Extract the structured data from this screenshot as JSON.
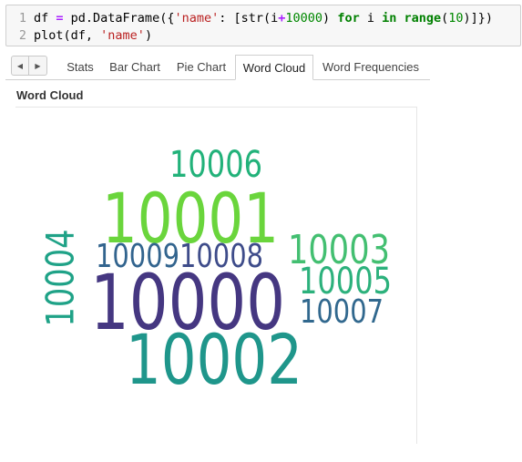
{
  "code": {
    "line_numbers": [
      "1",
      "2"
    ],
    "line1": [
      {
        "t": "df ",
        "c": "default"
      },
      {
        "t": "=",
        "c": "op"
      },
      {
        "t": " pd.DataFrame({",
        "c": "default"
      },
      {
        "t": "'name'",
        "c": "str"
      },
      {
        "t": ": [str(i",
        "c": "default"
      },
      {
        "t": "+",
        "c": "op"
      },
      {
        "t": "10000",
        "c": "num"
      },
      {
        "t": ") ",
        "c": "default"
      },
      {
        "t": "for",
        "c": "kw"
      },
      {
        "t": " i ",
        "c": "default"
      },
      {
        "t": "in",
        "c": "kw"
      },
      {
        "t": " ",
        "c": "default"
      },
      {
        "t": "range",
        "c": "kw"
      },
      {
        "t": "(",
        "c": "default"
      },
      {
        "t": "10",
        "c": "num"
      },
      {
        "t": ")]})",
        "c": "default"
      }
    ],
    "line2": [
      {
        "t": "plot(df, ",
        "c": "default"
      },
      {
        "t": "'name'",
        "c": "str"
      },
      {
        "t": ")",
        "c": "default"
      }
    ]
  },
  "tabs": {
    "prev_icon": "chevron-left-icon",
    "next_icon": "chevron-right-icon",
    "items": [
      {
        "label": "Stats",
        "active": false
      },
      {
        "label": "Bar Chart",
        "active": false
      },
      {
        "label": "Pie Chart",
        "active": false
      },
      {
        "label": "Word Cloud",
        "active": true
      },
      {
        "label": "Word Frequencies",
        "active": false
      }
    ]
  },
  "panel": {
    "title": "Word Cloud"
  },
  "word_cloud": {
    "words": [
      {
        "text": "10006",
        "color": "#22b27a",
        "rotated": false
      },
      {
        "text": "10001",
        "color": "#6ad53c",
        "rotated": false
      },
      {
        "text": "10004",
        "color": "#1fa287",
        "rotated": true
      },
      {
        "text": "10009",
        "color": "#32648e",
        "rotated": false
      },
      {
        "text": "10008",
        "color": "#3e4c8a",
        "rotated": false
      },
      {
        "text": "10003",
        "color": "#43bf71",
        "rotated": false
      },
      {
        "text": "10005",
        "color": "#2cb17c",
        "rotated": false
      },
      {
        "text": "10000",
        "color": "#453781",
        "rotated": false
      },
      {
        "text": "10007",
        "color": "#31688e",
        "rotated": false
      },
      {
        "text": "10002",
        "color": "#1f968b",
        "rotated": false
      }
    ]
  }
}
